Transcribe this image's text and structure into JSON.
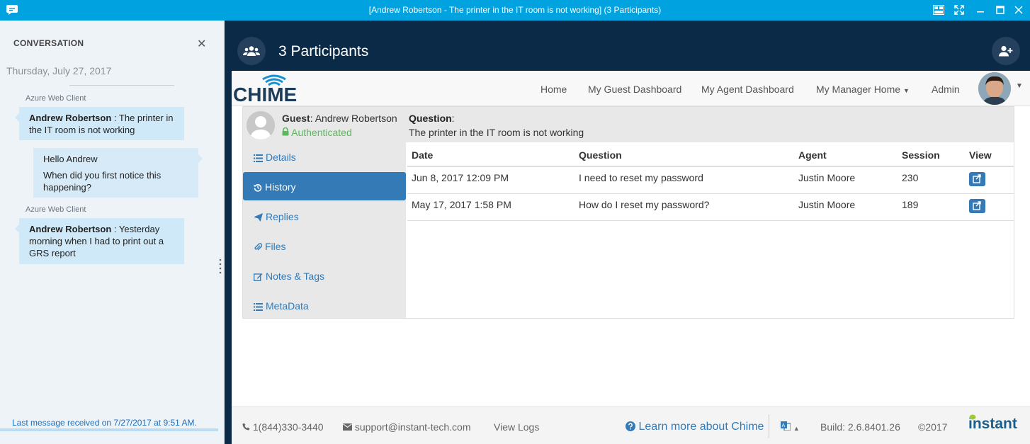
{
  "window": {
    "title": "[Andrew Robertson - The printer in the IT room is not working] (3 Participants)"
  },
  "conversation": {
    "header": "CONVERSATION",
    "date": "Thursday, July 27, 2017",
    "messages": [
      {
        "sender": "Azure Web Client",
        "author": "Andrew Robertson",
        "text": " : The printer in the IT room is not working"
      },
      {
        "lines": [
          "Hello Andrew",
          "When did you first notice this happening?"
        ]
      },
      {
        "sender": "Azure Web Client",
        "author": "Andrew Robertson",
        "text": " : Yesterday morning when I had to print out a GRS report"
      }
    ],
    "last_message": "Last message received on 7/27/2017 at 9:51 AM."
  },
  "participants": {
    "label": "3 Participants"
  },
  "nav": {
    "logo_text": "CHIME",
    "items": [
      "Home",
      "My Guest Dashboard",
      "My Agent Dashboard",
      "My Manager Home",
      "Admin"
    ]
  },
  "guest": {
    "label": "Guest",
    "name": ": Andrew Robertson",
    "status": "Authenticated",
    "question_label": "Question",
    "question_colon": ":",
    "question": "The printer in the IT room is not working"
  },
  "sidebar": {
    "items": [
      "Details",
      "History",
      "Replies",
      "Files",
      "Notes & Tags",
      "MetaData"
    ]
  },
  "history": {
    "columns": [
      "Date",
      "Question",
      "Agent",
      "Session",
      "View"
    ],
    "rows": [
      {
        "date": "Jun 8, 2017 12:09 PM",
        "question": "I need to reset my password",
        "agent": "Justin Moore",
        "session": "230"
      },
      {
        "date": "May 17, 2017 1:58 PM",
        "question": "How do I reset my password?",
        "agent": "Justin Moore",
        "session": "189"
      }
    ]
  },
  "footer": {
    "phone": "1(844)330-3440",
    "email": "support@instant-tech.com",
    "view_logs": "View Logs",
    "learn_more": "Learn more about Chime",
    "build": "Build: 2.6.8401.26",
    "copyright": "©2017",
    "brand": "instant"
  },
  "colors": {
    "titlebar": "#00a3e0",
    "header_bg": "#0a2a47",
    "accent": "#337ab7",
    "success": "#5cb85c",
    "bubble": "#cfe9f8"
  }
}
